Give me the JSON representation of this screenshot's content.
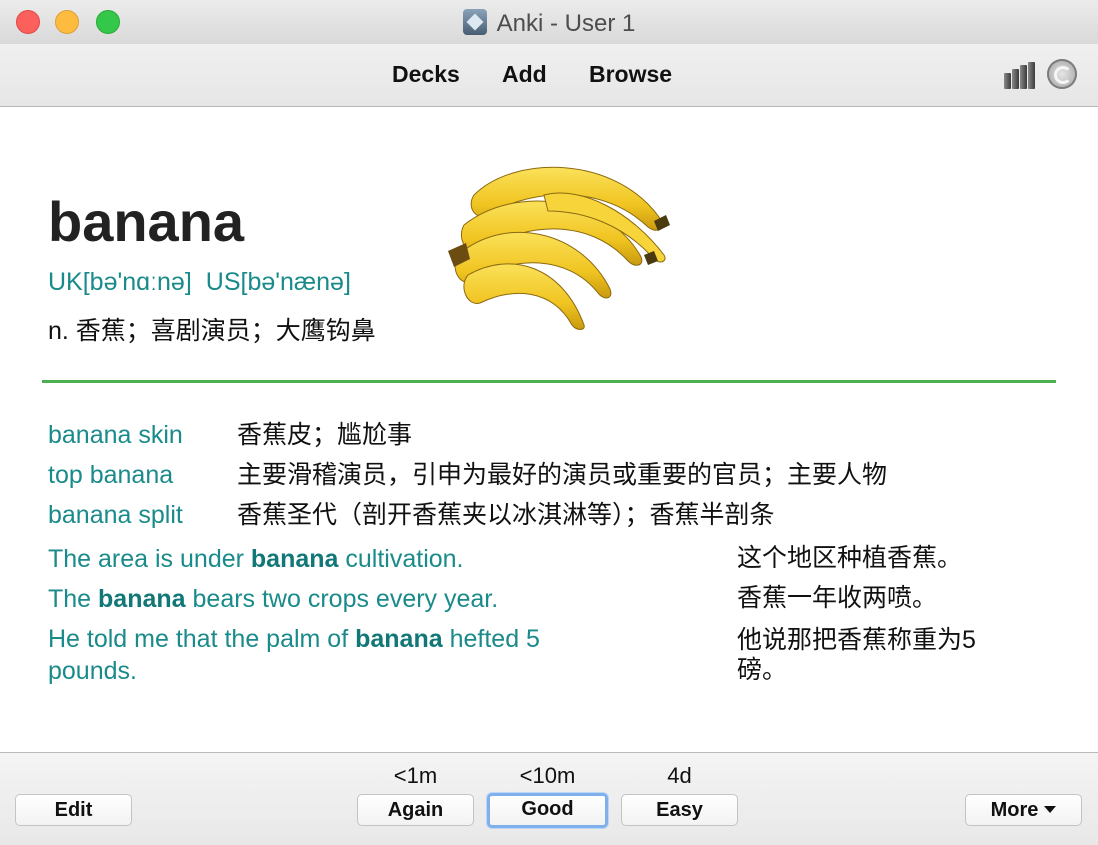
{
  "window": {
    "title": "Anki - User 1",
    "controls": [
      "close",
      "minimize",
      "zoom"
    ]
  },
  "toolbar": {
    "nav": [
      "Decks",
      "Add",
      "Browse"
    ],
    "icons": [
      "stats-icon",
      "sync-icon"
    ]
  },
  "card": {
    "word": "banana",
    "phonetic_uk": "UK[bə'nɑːnə]",
    "phonetic_us": "US[bə'nænə]",
    "definition": "n. 香蕉；喜剧演员；大鹰钩鼻",
    "image": "banana-bunch",
    "phrases": [
      {
        "en": "banana skin",
        "zh": "香蕉皮；尴尬事"
      },
      {
        "en": "top banana",
        "zh": "主要滑稽演员，引申为最好的演员或重要的官员；主要人物"
      },
      {
        "en": "banana split",
        "zh": "香蕉圣代（剖开香蕉夹以冰淇淋等）；香蕉半剖条"
      }
    ],
    "sentences": [
      {
        "pre": "The area is under ",
        "bold": "banana",
        "post": " cultivation.",
        "zh": "这个地区种植香蕉。"
      },
      {
        "pre": "The ",
        "bold": "banana",
        "post": " bears two crops every year.",
        "zh": "香蕉一年收两喷。"
      },
      {
        "pre": "He told me that the palm of ",
        "bold": "banana",
        "post": " hefted 5 pounds.",
        "zh": "他说那把香蕉称重为5磅。"
      }
    ]
  },
  "answer_bar": {
    "edit": "Edit",
    "more": "More",
    "buttons": [
      {
        "label": "Again",
        "interval": "<1m"
      },
      {
        "label": "Good",
        "interval": "<10m"
      },
      {
        "label": "Easy",
        "interval": "4d"
      }
    ]
  },
  "colors": {
    "accent": "#1a8a8a",
    "divider": "#4caf50",
    "focus": "#7fb0ec"
  }
}
